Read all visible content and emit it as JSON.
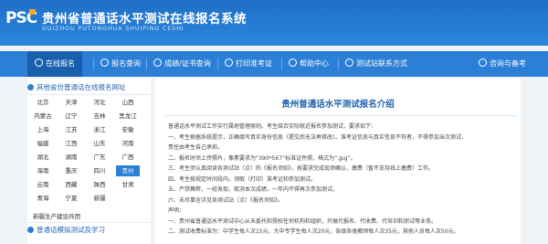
{
  "header": {
    "logo": "PSC",
    "title": "贵州省普通话水平测试在线报名系统",
    "subtitle": "GUIZHOU PUTONGHUA SHUIPING CESHI"
  },
  "nav": {
    "items": [
      "在线报名",
      "报名查询",
      "成绩/证书查询",
      "打印准考证",
      "帮助中心",
      "测试站联系方式"
    ],
    "right": "咨询与备考"
  },
  "sidebar": {
    "section1_title": "其他省份普通话在线报名网址",
    "provinces": [
      "北京",
      "天津",
      "河北",
      "山西",
      "内蒙古",
      "辽宁",
      "吉林",
      "黑龙江",
      "上海",
      "江苏",
      "浙江",
      "安徽",
      "福建",
      "江西",
      "山东",
      "河南",
      "湖北",
      "湖南",
      "广东",
      "广西",
      "海南",
      "重庆",
      "四川",
      "贵州",
      "云南",
      "西藏",
      "陕西",
      "甘肃",
      "青海",
      "宁夏",
      "新疆",
      ""
    ],
    "selected": "贵州",
    "footer_link": "新疆生产建设兵团",
    "section2_title": "普通话模拟测试及学习"
  },
  "content": {
    "title": "贵州普通话水平测试报名介绍",
    "lines": [
      "普通话水平测试工作实行属地管理原则。考生结合实际就近报名参加测试，要求如下：",
      "一、考生根据系统提示，正确填写真实身份信息（提交后无法再修改）。准考证信息与真实信息不符者，不得参加当次测试，",
      "责任由考生自己承担。",
      "二、报名时须上传照片，像素要求为“390*567”标准证件照，格式为“.jpg”。",
      "三、考生须认真阅读各测试站（点）的《报名须知》，按要求完成现场确认、缴费（暂不支持线上缴费）工作。",
      "四、考生按规定时间段内，领取（打印）准考证和参加测试。",
      "五、严禁舞弊，一经发现，取消本次成绩，一年内不得再次参加测试。",
      "六、未尽事宜详见各测试站（点）《报名须知》。",
      "声明：",
      "一、贵州省普通话水平测试中心从未委托和授权任何机构和组织，开展代报名、代收费、代培训和测试等业务。",
      "二、测试收费标准为：中学生每人次15元，大中专学生每人次20元，各级各类教师每人次35元，其他人员每人次50元。"
    ]
  },
  "colors": {
    "primary": "#2b7fd6",
    "header": "#1f6fc6",
    "accent": "#f5a623"
  }
}
